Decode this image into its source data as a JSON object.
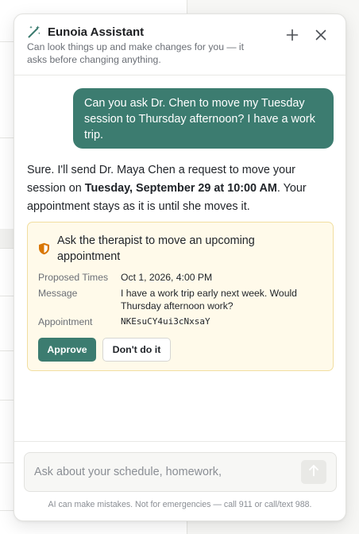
{
  "assistant": {
    "title": "Eunoia Assistant",
    "subtitle": "Can look things up and make changes for you — it asks before changing anything."
  },
  "messages": {
    "user": "Can you ask Dr. Chen to move my Tuesday session to Thursday afternoon? I have a work trip.",
    "assistant_part1": "Sure. I'll send Dr. Maya Chen a request to move your session on ",
    "assistant_bold": "Tuesday, September 29 at 10:00 AM",
    "assistant_part2": ". Your appointment stays as it is until she moves it."
  },
  "action_card": {
    "title": "Ask the therapist to move an upcoming appointment",
    "fields": [
      {
        "label": "Proposed Times",
        "value": "Oct 1, 2026, 4:00 PM"
      },
      {
        "label": "Message",
        "value": "I have a work trip early next week. Would Thursday afternoon work?"
      },
      {
        "label": "Appointment",
        "value": "NKEsuCY4ui3cNxsaY"
      }
    ],
    "approve_label": "Approve",
    "deny_label": "Don't do it"
  },
  "composer": {
    "placeholder": "Ask about your schedule, homework,",
    "value": ""
  },
  "disclaimer": "AI can make mistakes. Not for emergencies — call 911 or call/text 988.",
  "colors": {
    "accent": "#3c7c70",
    "card_bg": "#fffaea",
    "card_border": "#f1dea0",
    "shield": "#d97706"
  },
  "icons": {
    "header": "magic-wand-icon",
    "new_chat": "plus-icon",
    "close": "close-icon",
    "card": "shield-icon",
    "send": "arrow-up-icon"
  }
}
